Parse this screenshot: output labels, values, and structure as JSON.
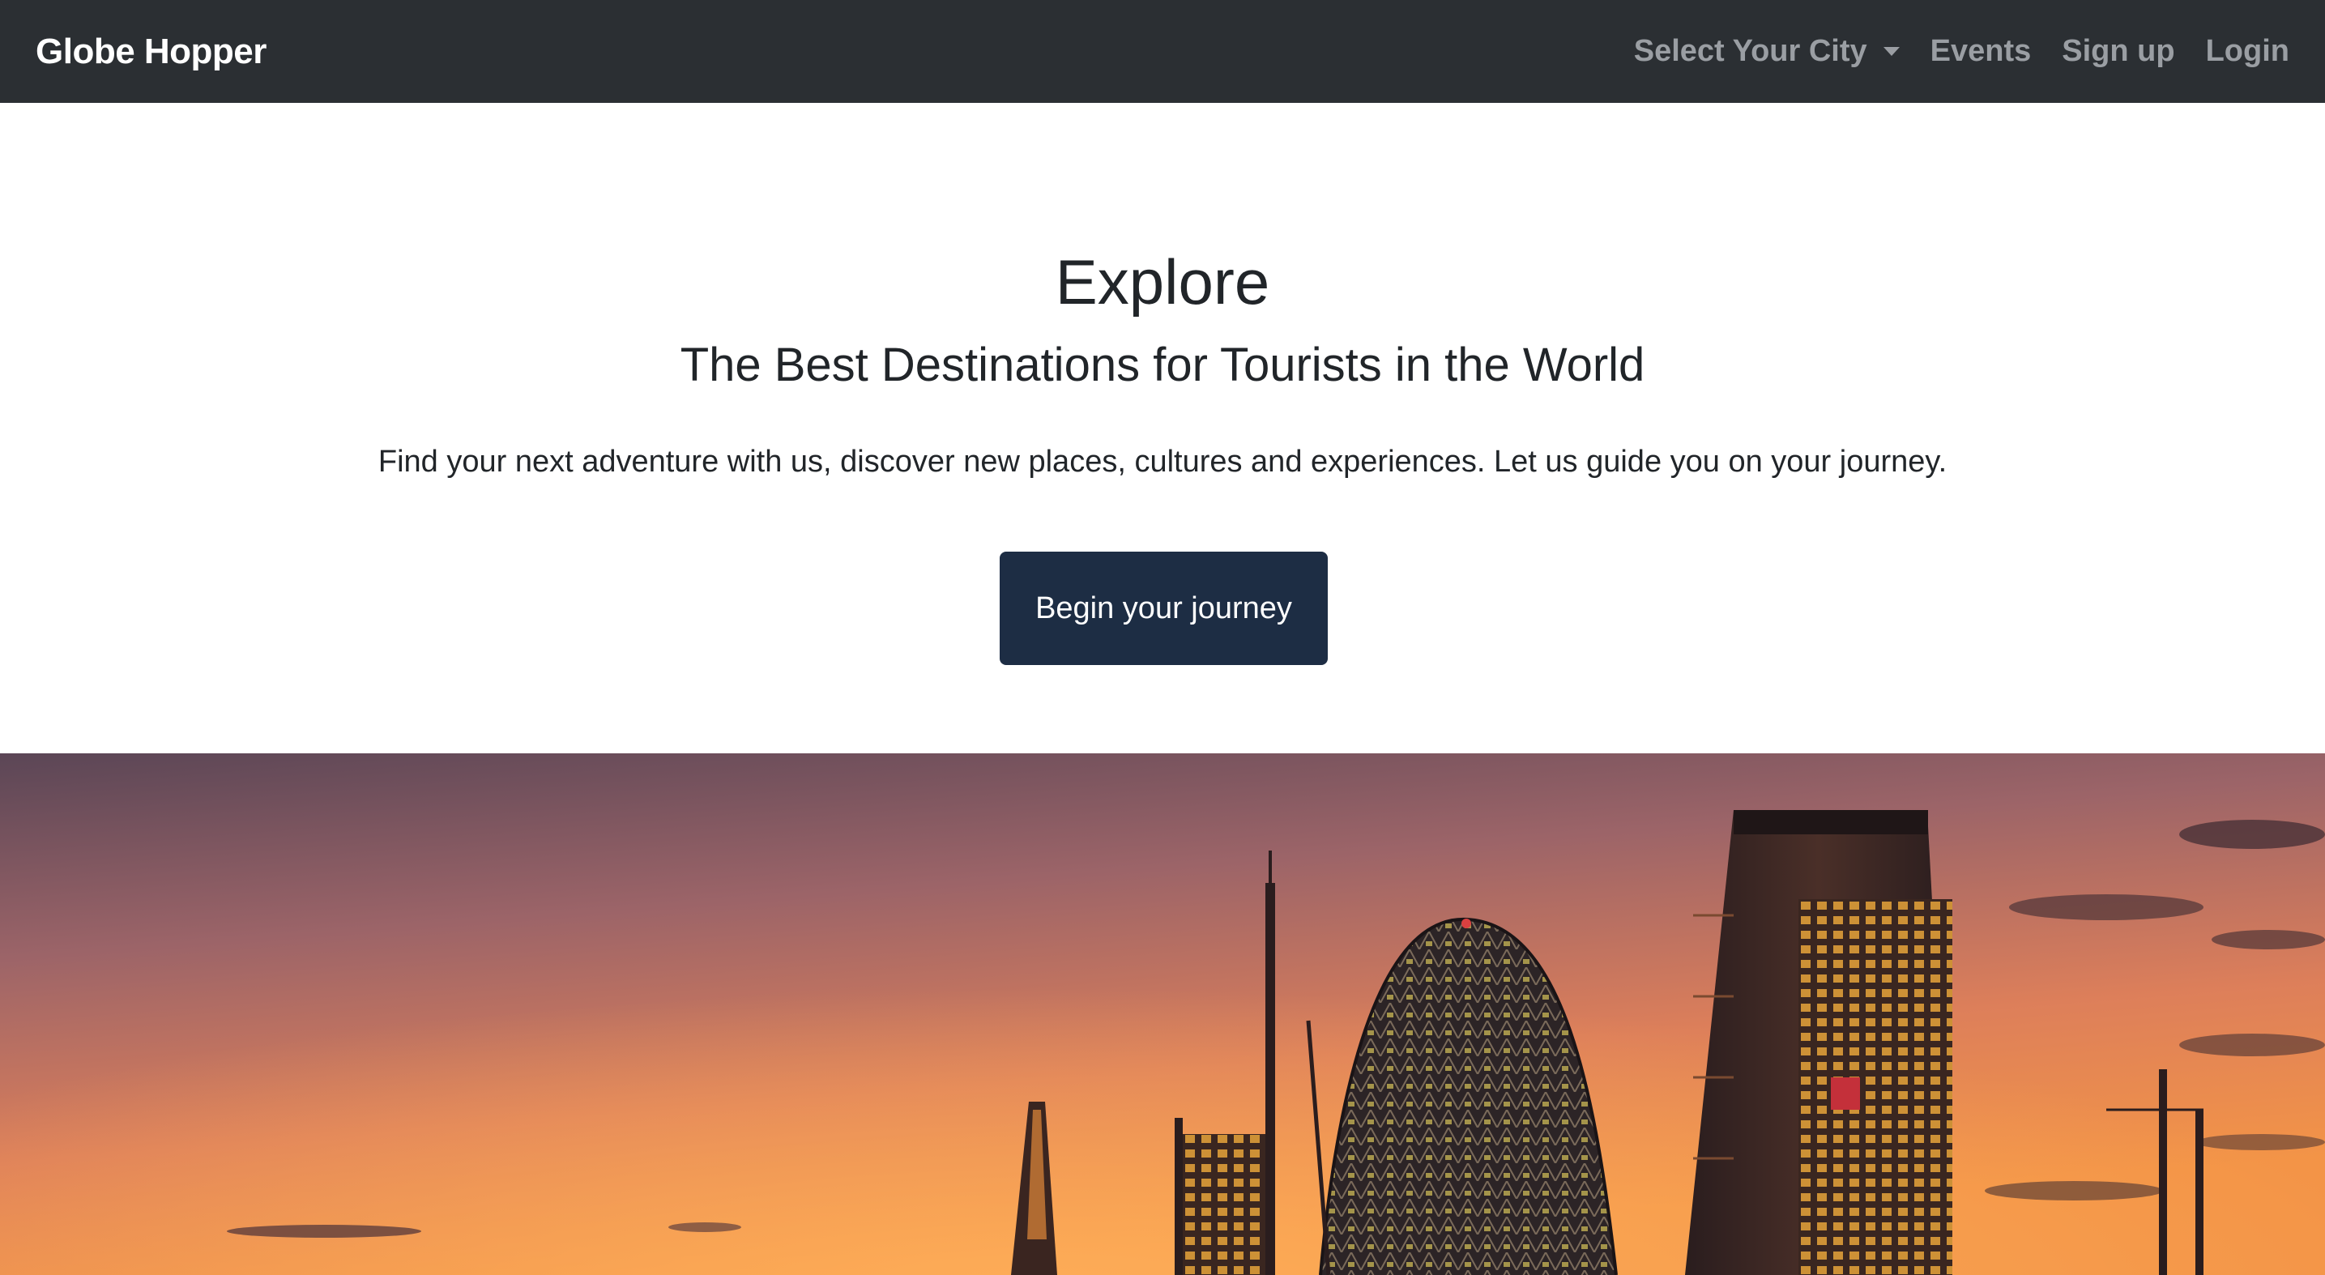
{
  "navbar": {
    "brand": "Globe Hopper",
    "links": [
      {
        "label": "Select Your City",
        "dropdown": true
      },
      {
        "label": "Events"
      },
      {
        "label": "Sign up"
      },
      {
        "label": "Login"
      }
    ]
  },
  "hero": {
    "title": "Explore",
    "subtitle": "The Best Destinations for Tourists in the World",
    "description": "Find your next adventure with us, discover new places, cultures and experiences. Let us guide you on your journey.",
    "cta_label": "Begin your journey"
  },
  "colors": {
    "navbar_bg": "#2b2f33",
    "cta_bg": "#1d2d44",
    "sky_top": "#5b4656",
    "sky_bottom": "#f08a4a"
  }
}
